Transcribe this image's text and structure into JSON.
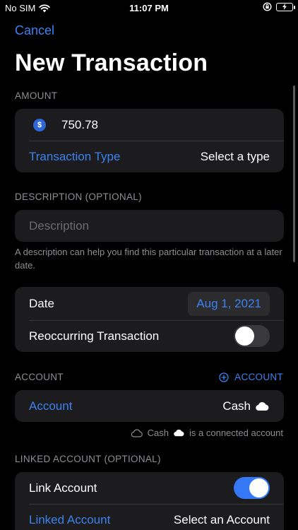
{
  "status_bar": {
    "carrier": "No SIM",
    "time": "11:07 PM"
  },
  "nav": {
    "cancel_label": "Cancel",
    "title": "New Transaction"
  },
  "amount_section": {
    "header": "AMOUNT",
    "currency_symbol": "$",
    "amount_value": "750.78",
    "type_label": "Transaction Type",
    "type_value": "Select a type"
  },
  "description_section": {
    "header": "DESCRIPTION (OPTIONAL)",
    "placeholder": "Description",
    "footer": "A description can help you find this particular transaction at a later date."
  },
  "date_section": {
    "date_label": "Date",
    "date_value": "Aug 1, 2021",
    "recurring_label": "Reoccurring Transaction",
    "recurring_on": false
  },
  "account_section": {
    "header": "ACCOUNT",
    "action_label": "ACCOUNT",
    "account_label": "Account",
    "account_value": "Cash",
    "connected_name": "Cash",
    "connected_suffix": "is a connected account"
  },
  "linked_section": {
    "header": "LINKED ACCOUNT (OPTIONAL)",
    "link_label": "Link Account",
    "link_on": true,
    "linked_label": "Linked Account",
    "linked_value": "Select an Account"
  },
  "colors": {
    "accent": "#3b82f0",
    "background": "#000000",
    "group": "#1c1c1e",
    "toggle_on": "#3478f6"
  },
  "icons": [
    "wifi-icon",
    "orientation-lock-icon",
    "battery-charging-icon",
    "dollar-icon",
    "plus-circle-icon",
    "cloud-icon"
  ]
}
